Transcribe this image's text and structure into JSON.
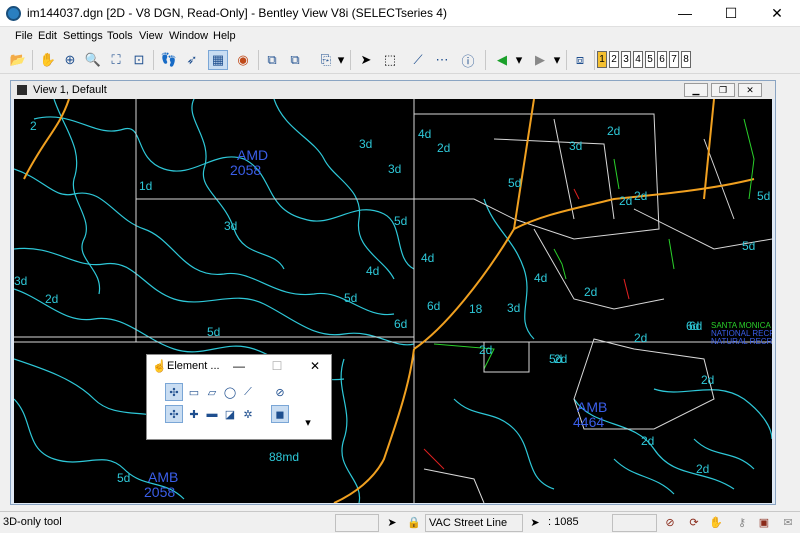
{
  "window": {
    "title": "im144037.dgn [2D - V8 DGN, Read-Only] - Bentley View V8i (SELECTseries 4)",
    "minimize": "—",
    "maximize": "☐",
    "close": "✕"
  },
  "menu": [
    "File",
    "Edit",
    "Settings",
    "Tools",
    "View",
    "Window",
    "Help"
  ],
  "toolbar": {
    "view_numbers": [
      "1",
      "2",
      "3",
      "4",
      "5",
      "6",
      "7",
      "8"
    ]
  },
  "view": {
    "title": "View 1, Default",
    "labels": [
      {
        "text": "2"
      },
      {
        "text": "1d"
      },
      {
        "text": "AMD"
      },
      {
        "text": "2058"
      },
      {
        "text": "3d"
      },
      {
        "text": "3d"
      },
      {
        "text": "2d"
      },
      {
        "text": "4d"
      },
      {
        "text": "5d"
      },
      {
        "text": "3d"
      },
      {
        "text": "5d"
      },
      {
        "text": "4d"
      },
      {
        "text": "3d"
      },
      {
        "text": "2d"
      },
      {
        "text": "5d"
      },
      {
        "text": "6d"
      },
      {
        "text": "5d"
      },
      {
        "text": "4d"
      },
      {
        "text": "6d"
      },
      {
        "text": "18"
      },
      {
        "text": "3d"
      },
      {
        "text": "4d"
      },
      {
        "text": "2d"
      },
      {
        "text": "2d"
      },
      {
        "text": "3d"
      },
      {
        "text": "2d"
      },
      {
        "text": "5d"
      },
      {
        "text": "5d"
      },
      {
        "text": "6d"
      },
      {
        "text": "2d"
      },
      {
        "text": "2d"
      },
      {
        "text": "AMB"
      },
      {
        "text": "4464"
      },
      {
        "text": "2d"
      },
      {
        "text": "2d"
      },
      {
        "text": "5d"
      },
      {
        "text": "88md"
      },
      {
        "text": "AMB"
      },
      {
        "text": "2058"
      },
      {
        "text": "5d"
      },
      {
        "text": "2d"
      },
      {
        "text": "2d"
      },
      {
        "text": "2d"
      },
      {
        "text": "6d"
      },
      {
        "text": "SANTA MONICA"
      },
      {
        "text": "NATIONAL RECR"
      },
      {
        "text": "NATURAL RECRE"
      }
    ]
  },
  "element_dialog": {
    "title": "Element ...",
    "minimize": "—",
    "maximize": "☐",
    "close": "✕"
  },
  "status": {
    "message": "3D-only tool",
    "level": "VAC Street Line",
    "selection": ": 1085"
  },
  "colors": {
    "canvas": "#000000",
    "contour": "#2ec8d8",
    "parcel": "#ffffff",
    "label_blue": "#3a5ee8",
    "road": "#f0a020",
    "accent_green": "#2ad02a"
  }
}
